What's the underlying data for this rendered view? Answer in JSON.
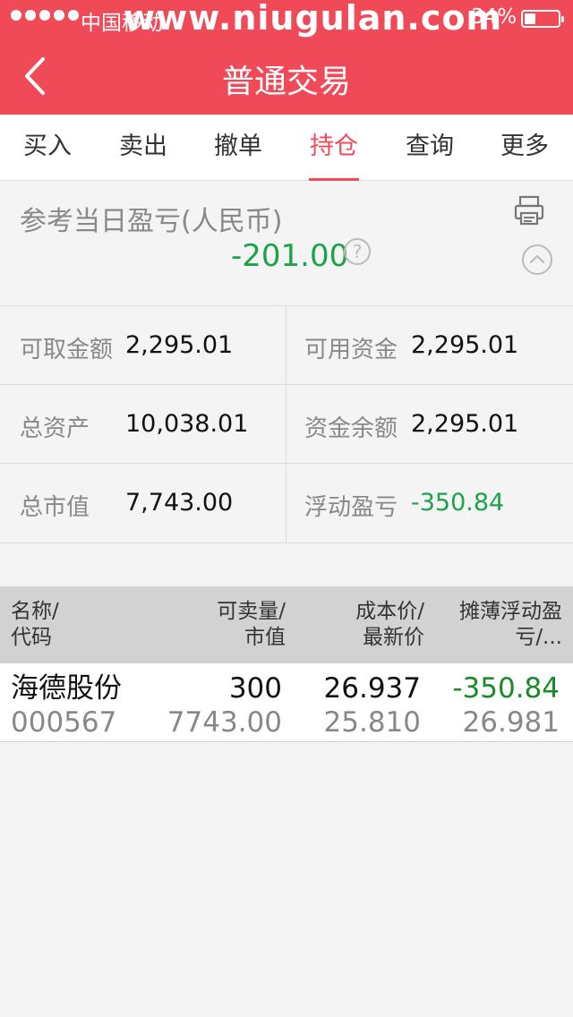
{
  "status_bar": {
    "carrier": "中国移动",
    "watermark": "www.niugulan.com",
    "battery_percent": "34%",
    "battery_level": 0.34
  },
  "navbar": {
    "title": "普通交易"
  },
  "tabs": [
    {
      "label": "买入",
      "active": false
    },
    {
      "label": "卖出",
      "active": false
    },
    {
      "label": "撤单",
      "active": false
    },
    {
      "label": "持仓",
      "active": true
    },
    {
      "label": "查询",
      "active": false
    },
    {
      "label": "更多",
      "active": false
    }
  ],
  "summary": {
    "label": "参考当日盈亏(人民币)",
    "value": "-201.00",
    "help": "?"
  },
  "account": {
    "withdrawable_label": "可取金额",
    "withdrawable_value": "2,295.01",
    "available_label": "可用资金",
    "available_value": "2,295.01",
    "total_assets_label": "总资产",
    "total_assets_value": "10,038.01",
    "balance_label": "资金余额",
    "balance_value": "2,295.01",
    "market_value_label": "总市值",
    "market_value_value": "7,743.00",
    "floating_pl_label": "浮动盈亏",
    "floating_pl_value": "-350.84"
  },
  "table": {
    "headers": {
      "name_1": "名称/",
      "name_2": "代码",
      "qty_1": "可卖量/",
      "qty_2": "市值",
      "cost_1": "成本价/",
      "cost_2": "最新价",
      "pl_1": "摊薄浮动盈",
      "pl_2": "亏/..."
    },
    "rows": [
      {
        "name": "海德股份",
        "code": "000567",
        "sellable": "300",
        "market_value": "7743.00",
        "cost_price": "26.937",
        "last_price": "25.810",
        "floating_pl": "-350.84",
        "pl_sub": "26.981"
      }
    ]
  },
  "colors": {
    "brand": "#f04a58",
    "loss_green": "#1aa34a"
  }
}
